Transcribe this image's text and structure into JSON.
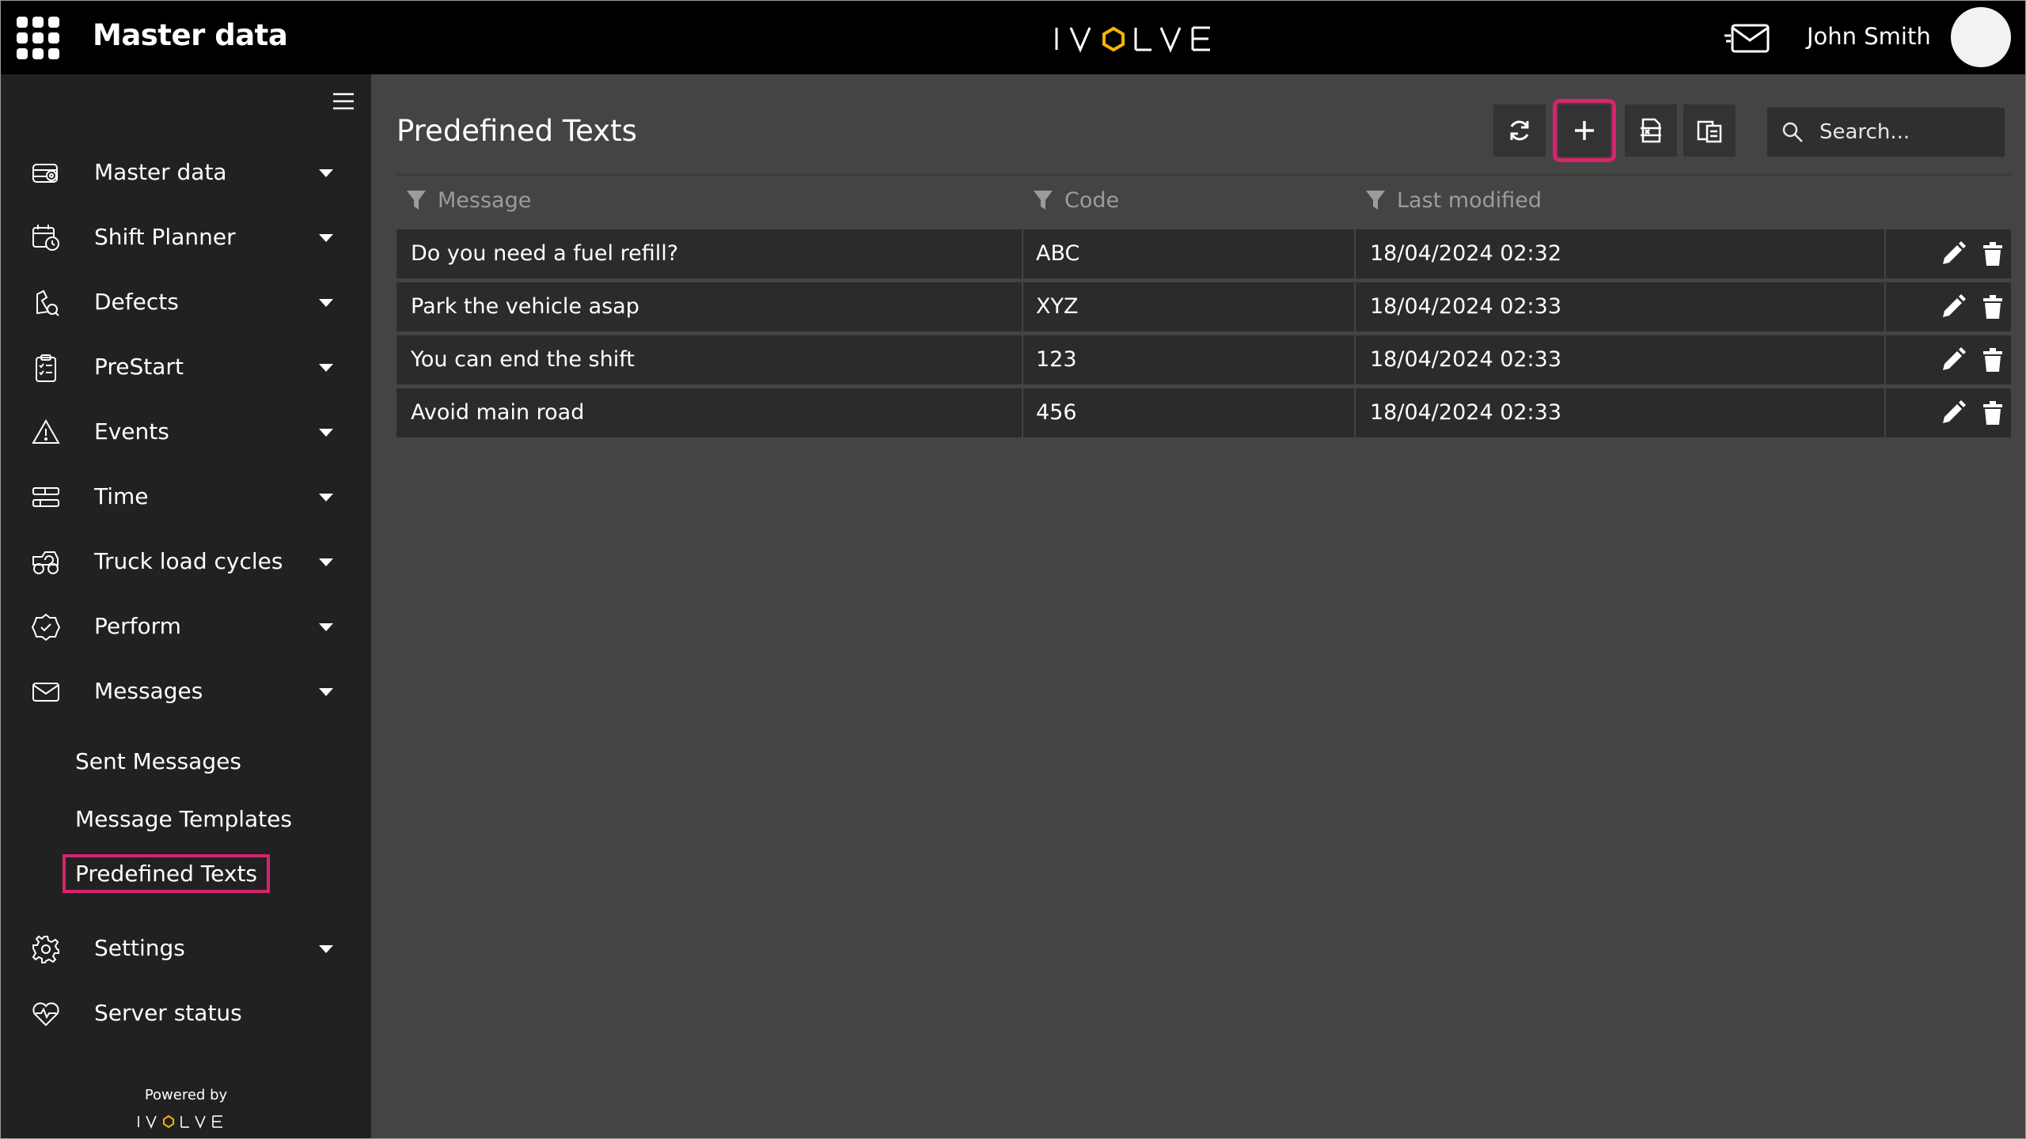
{
  "header": {
    "app_title": "Master data",
    "brand": "IVOLVE",
    "user_name": "John Smith"
  },
  "sidebar": {
    "items": [
      {
        "label": "Master data",
        "icon": "database-icon"
      },
      {
        "label": "Shift Planner",
        "icon": "calendar-clock-icon"
      },
      {
        "label": "Defects",
        "icon": "defect-tool-icon"
      },
      {
        "label": "PreStart",
        "icon": "clipboard-checklist-icon"
      },
      {
        "label": "Events",
        "icon": "warning-triangle-icon"
      },
      {
        "label": "Time",
        "icon": "timeline-icon"
      },
      {
        "label": "Truck load cycles",
        "icon": "truck-cycle-icon"
      },
      {
        "label": "Perform",
        "icon": "check-badge-icon"
      },
      {
        "label": "Messages",
        "icon": "envelope-icon"
      }
    ],
    "messages_sub": [
      {
        "label": "Sent Messages"
      },
      {
        "label": "Message Templates"
      },
      {
        "label": "Predefined Texts"
      }
    ],
    "bottom_items": [
      {
        "label": "Settings",
        "icon": "gear-icon"
      },
      {
        "label": "Server status",
        "icon": "heart-pulse-icon"
      }
    ],
    "powered_by": "Powered by",
    "powered_logo": "IVOLVE"
  },
  "main": {
    "title": "Predefined Texts",
    "search_placeholder": "Search...",
    "columns": [
      "Message",
      "Code",
      "Last modified"
    ],
    "rows": [
      {
        "message": "Do you need a fuel refill?",
        "code": "ABC",
        "modified": "18/04/2024 02:32"
      },
      {
        "message": "Park the vehicle asap",
        "code": "XYZ",
        "modified": "18/04/2024 02:33"
      },
      {
        "message": "You can end the shift",
        "code": "123",
        "modified": "18/04/2024 02:33"
      },
      {
        "message": "Avoid main road",
        "code": "456",
        "modified": "18/04/2024 02:33"
      }
    ]
  },
  "colors": {
    "highlight": "#d6246e",
    "brand_accent": "#f5b400",
    "topbar": "#000000",
    "sidebar": "#212121",
    "content": "#444444"
  }
}
